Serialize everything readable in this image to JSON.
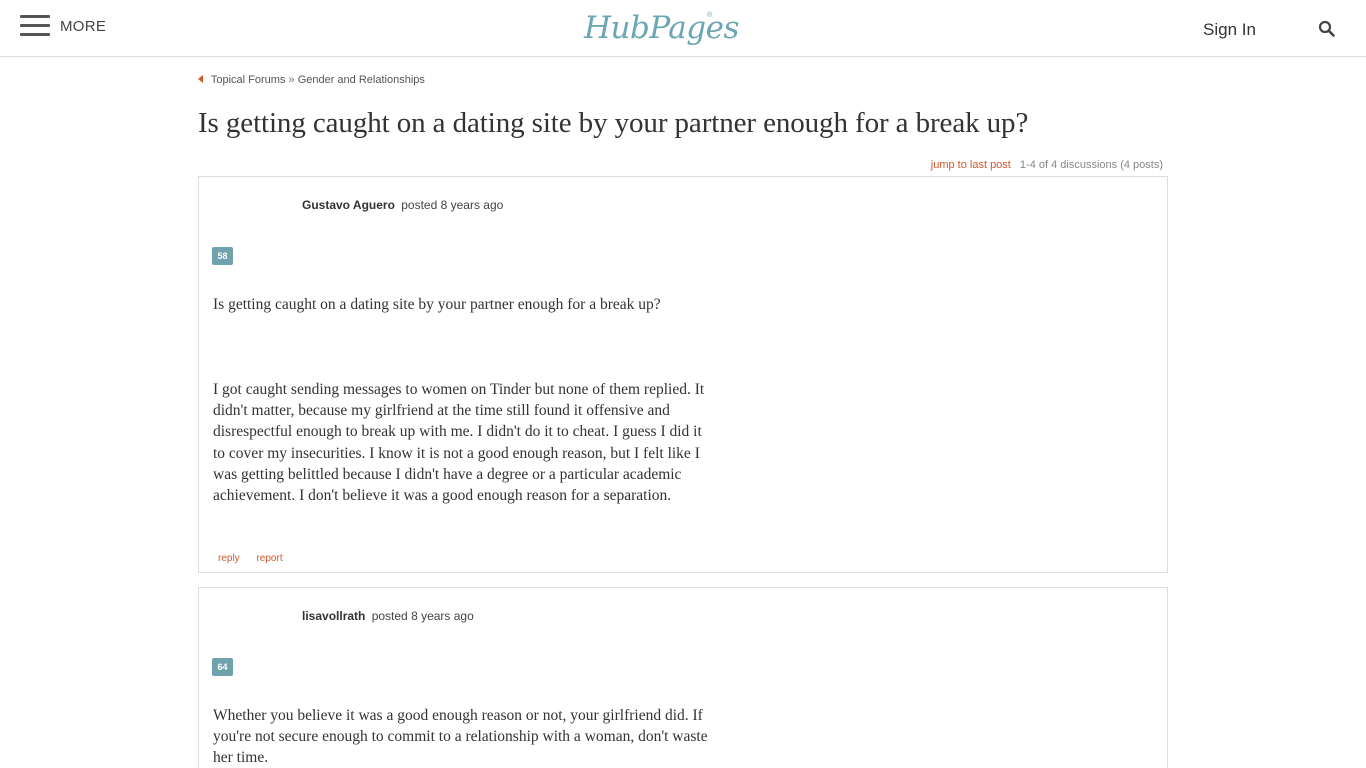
{
  "header": {
    "more_label": "MORE",
    "logo_text": "HubPages",
    "logo_mark": "®",
    "signin_label": "Sign In"
  },
  "breadcrumb": {
    "items": [
      "Topical Forums",
      "Gender and Relationships"
    ],
    "separator": "»"
  },
  "page": {
    "title": "Is getting caught on a dating site by your partner enough for a break up?"
  },
  "meta": {
    "jump_link": "jump to last post",
    "count_text": "1-4 of 4 discussions (4 posts)"
  },
  "posts": [
    {
      "author": "Gustavo Aguero",
      "posted": "posted 8 years ago",
      "score": "58",
      "question": "Is getting caught on a dating site by your partner enough for a break up?",
      "body": "I got caught sending messages to women on Tinder but none of them replied. It didn't matter, because my girlfriend at the time still found it offensive and disrespectful enough to break up with me. I didn't do it to cheat. I guess I did it to cover my insecurities. I know it is not a good enough reason, but I felt like I was getting belittled because I didn't have a degree or a particular academic achievement. I don't believe it was a good enough reason for a separation.",
      "reply_label": "reply",
      "report_label": "report"
    },
    {
      "author": "lisavollrath",
      "posted": "posted 8 years ago",
      "score": "64",
      "body": "Whether you believe it was a good enough reason or not, your girlfriend did. If you're not secure enough to commit to a relationship with a woman, don't waste her time."
    }
  ],
  "colors": {
    "accent": "#d2582c",
    "brand": "#6aa6b4",
    "score_badge": "#6fa2ad"
  },
  "icons": {
    "menu": "hamburger-menu-icon",
    "search": "search-icon",
    "breadcrumb_back": "triangle-left-icon"
  }
}
